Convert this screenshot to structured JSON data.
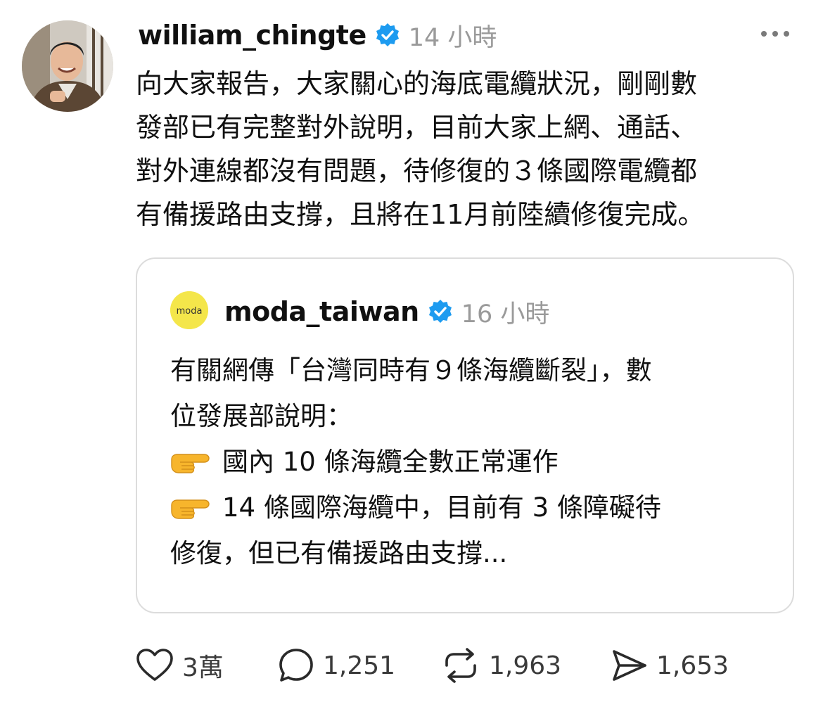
{
  "post": {
    "username": "william_chingte",
    "time": "14 小時",
    "more_icon": "more-horizontal-icon",
    "text_lines": [
      "向大家報告，大家關心的海底電纜狀況，剛剛數",
      "發部已有完整對外說明，目前大家上網、通話、",
      "對外連線都沒有問題，待修復的３條國際電纜都",
      "有備援路由支撐，且將在11月前陸續修復完成。"
    ]
  },
  "quote": {
    "username": "moda_taiwan",
    "time": "16 小時",
    "avatar_text": "moda",
    "text_lines": [
      "有關網傳「台灣同時有９條海纜斷裂」，數",
      "位發展部說明："
    ],
    "bullets": [
      "國內 10 條海纜全數正常運作",
      "14 條國際海纜中，目前有 3 條障礙待"
    ],
    "continuation": "修復，但已有備援路由支撐..."
  },
  "actions": {
    "likes": "3萬",
    "replies": "1,251",
    "reposts": "1,963",
    "shares": "1,653"
  },
  "colors": {
    "verified": "#1d9bf0",
    "muted_text": "#9a9a9a",
    "quote_border": "#dcdcdc",
    "moda_yellow": "#f4e64a"
  }
}
